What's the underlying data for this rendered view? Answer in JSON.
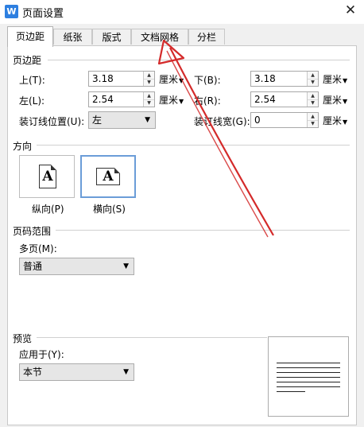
{
  "window": {
    "title": "页面设置",
    "app_icon": "W"
  },
  "tabs": [
    "页边距",
    "纸张",
    "版式",
    "文档网格",
    "分栏"
  ],
  "margins": {
    "section": "页边距",
    "top_label": "上(T):",
    "top_value": "3.18",
    "bottom_label": "下(B):",
    "bottom_value": "3.18",
    "left_label": "左(L):",
    "left_value": "2.54",
    "right_label": "右(R):",
    "right_value": "2.54",
    "gutter_pos_label": "装订线位置(U):",
    "gutter_pos_value": "左",
    "gutter_width_label": "装订线宽(G):",
    "gutter_width_value": "0",
    "unit": "厘米"
  },
  "orientation": {
    "section": "方向",
    "portrait": "纵向(P)",
    "landscape": "横向(S)",
    "icon_letter": "A",
    "selected": "landscape"
  },
  "page_range": {
    "section": "页码范围",
    "multi_label": "多页(M):",
    "multi_value": "普通"
  },
  "preview": {
    "section": "预览",
    "apply_label": "应用于(Y):",
    "apply_value": "本节"
  },
  "colors": {
    "annotation_arrow": "#d42a2a",
    "selection_border": "#6b9dd8",
    "app_icon": "#2d7fe0"
  }
}
